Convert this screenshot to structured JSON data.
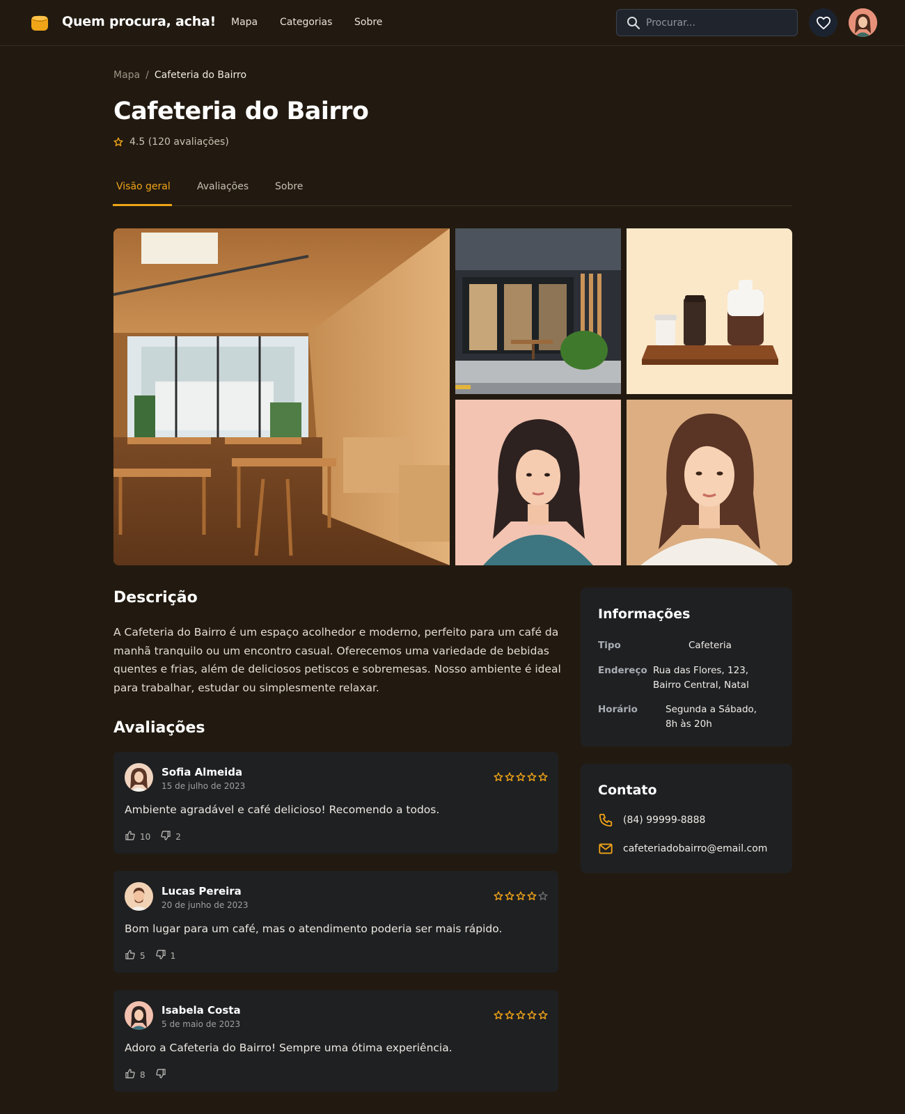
{
  "header": {
    "brand": "Quem procura, acha!",
    "nav": [
      "Mapa",
      "Categorias",
      "Sobre"
    ],
    "search_placeholder": "Procurar...",
    "accent_color": "#f0a418"
  },
  "breadcrumb": {
    "parent": "Mapa",
    "separator": "/",
    "current": "Cafeteria do Bairro"
  },
  "place": {
    "name": "Cafeteria do Bairro",
    "rating": "4.5",
    "rating_text": "4.5 (120 avaliações)"
  },
  "tabs": [
    "Visão geral",
    "Avaliações",
    "Sobre"
  ],
  "active_tab": "Visão geral",
  "description": {
    "heading": "Descrição",
    "text": "A Cafeteria do Bairro é um espaço acolhedor e moderno, perfeito para um café da manhã tranquilo ou um encontro casual. Oferecemos uma variedade de bebidas quentes e frias, além de deliciosos petiscos e sobremesas. Nosso ambiente é ideal para trabalhar, estudar ou simplesmente relaxar."
  },
  "reviews_heading": "Avaliações",
  "reviews": [
    {
      "name": "Sofia Almeida",
      "date": "15 de julho de 2023",
      "stars": 5,
      "text": "Ambiente agradável e café delicioso! Recomendo a todos.",
      "likes": "10",
      "dislikes": "2"
    },
    {
      "name": "Lucas Pereira",
      "date": "20 de junho de 2023",
      "stars": 4,
      "text": "Bom lugar para um café, mas o atendimento poderia ser mais rápido.",
      "likes": "5",
      "dislikes": "1"
    },
    {
      "name": "Isabela Costa",
      "date": "5 de maio de 2023",
      "stars": 5,
      "text": "Adoro a Cafeteria do Bairro! Sempre uma ótima experiência.",
      "likes": "8",
      "dislikes": ""
    }
  ],
  "info": {
    "heading": "Informações",
    "type_label": "Tipo",
    "type_value": "Cafeteria",
    "address_label": "Endereço",
    "address_line1": "Rua das Flores, 123,",
    "address_line2": "Bairro Central, Natal",
    "hours_label": "Horário",
    "hours_line1": "Segunda a Sábado,",
    "hours_line2": "8h às 20h"
  },
  "contact": {
    "heading": "Contato",
    "phone": "(84) 99999-8888",
    "email": "cafeteriadobairro@email.com"
  },
  "icons": [
    "logo-icon",
    "search-icon",
    "heart-icon",
    "star-icon",
    "thumbs-up-icon",
    "thumbs-down-icon",
    "phone-icon",
    "mail-icon"
  ]
}
